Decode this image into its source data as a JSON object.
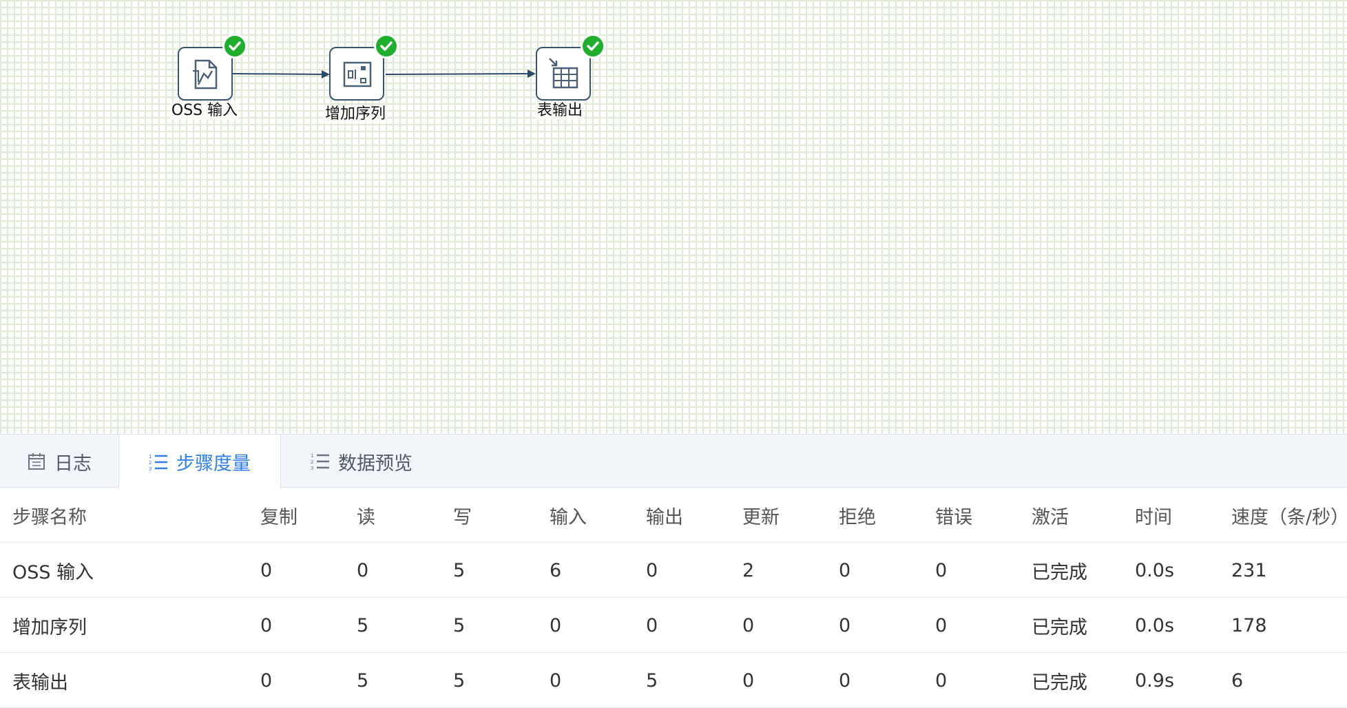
{
  "canvas": {
    "nodes": [
      {
        "id": "oss",
        "label": "OSS 输入",
        "icon": "oss-file-icon",
        "status": "success"
      },
      {
        "id": "seq",
        "label": "增加序列",
        "icon": "sequence-icon",
        "status": "success"
      },
      {
        "id": "out",
        "label": "表输出",
        "icon": "table-output-icon",
        "status": "success"
      }
    ],
    "colors": {
      "grid": "#dfe9d3",
      "node_border": "#3a546c",
      "success": "#1fae2d",
      "arrow": "#2c4a66"
    }
  },
  "tabs": [
    {
      "label": "日志",
      "icon": "calendar-icon",
      "active": false
    },
    {
      "label": "步骤度量",
      "icon": "numbered-list-icon",
      "active": true
    },
    {
      "label": "数据预览",
      "icon": "numbered-list-icon",
      "active": false
    }
  ],
  "accent_color": "#2f7ef2",
  "metrics_table": {
    "columns": [
      "步骤名称",
      "复制",
      "读",
      "写",
      "输入",
      "输出",
      "更新",
      "拒绝",
      "错误",
      "激活",
      "时间",
      "速度（条/秒）"
    ],
    "rows": [
      [
        "OSS 输入",
        "0",
        "0",
        "5",
        "6",
        "0",
        "2",
        "0",
        "0",
        "已完成",
        "0.0s",
        "231"
      ],
      [
        "增加序列",
        "0",
        "5",
        "5",
        "0",
        "0",
        "0",
        "0",
        "0",
        "已完成",
        "0.0s",
        "178"
      ],
      [
        "表输出",
        "0",
        "5",
        "5",
        "0",
        "5",
        "0",
        "0",
        "0",
        "已完成",
        "0.9s",
        "6"
      ]
    ]
  }
}
